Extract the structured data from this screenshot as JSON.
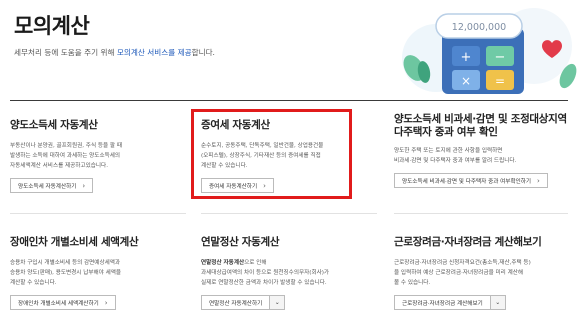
{
  "header": {
    "title": "모의계산",
    "desc_before": "세무처리 등에 도움을 주기 위해 ",
    "desc_highlight": "모의계산 서비스를 제공",
    "desc_after": "합니다.",
    "illustration_amount": "12,000,000"
  },
  "cards": [
    {
      "title": "양도소득세 자동계산",
      "desc": [
        "부동산이나 분양권, 골프회원권, 주식 등을 팔 때",
        "발생하는 소득에 대하여 과세하는 양도소득세의",
        "자동세액계산 서비스를 제공하고있습니다."
      ],
      "button": "양도소득세 자동계산하기"
    },
    {
      "title": "증여세 자동계산",
      "desc": [
        "순수토지, 공동주택, 단독주택, 일반건물, 상업용건물",
        "(오피스텔), 상장주식, 기타재산 등의 증여세를 직접",
        "계산할 수 있습니다."
      ],
      "button": "증여세 자동계산하기"
    },
    {
      "title_line1": "양도소득세 비과세·감면 및 조정대상지역",
      "title_line2": "다주택자 중과 여부 확인",
      "desc": [
        "양도한 주택 또는 토지에 관한 사항을 입력하면",
        "비과세·감면 및 다주택자 중과 여부를 알려 드립니다."
      ],
      "button": "양도소득세 비과세·감면 및 다주택자 중과 여부확인하기"
    },
    {
      "title": "장애인차 개별소비세 세액계산",
      "desc": [
        "승용차 구입시 개별소비세 등의 감면예상세액과",
        "승용차 양도(판매), 용도변경시 납부해야 세액을",
        "계산할 수 있습니다."
      ],
      "button": "장애인차 개별소비세 세액계산하기"
    },
    {
      "title": "연말정산 자동계산",
      "desc_bold": "연말정산 자동계산",
      "desc_after_bold": "으로 인해",
      "desc": [
        "과세대상급여액의 차이 등으로 원천징수의무자(회사)가",
        "실제로 연말정산한 금액과 차이가 발생할 수 있습니다."
      ],
      "select": "연말정산 자동계산하기"
    },
    {
      "title": "근로장려금·자녀장려금 계산해보기",
      "desc": [
        "근로장려금·자녀장려금 신청자격요건(총소득,재산,주택 등)",
        "을 입력하여 예상 근로장려금·자녀장려금을 미리 계산해",
        "볼 수 있습니다."
      ],
      "select": "근로장려금·자녀장려금 계산해보기"
    }
  ],
  "colors": {
    "highlight_border": "#e11b1b",
    "link_blue": "#1a56b8"
  }
}
